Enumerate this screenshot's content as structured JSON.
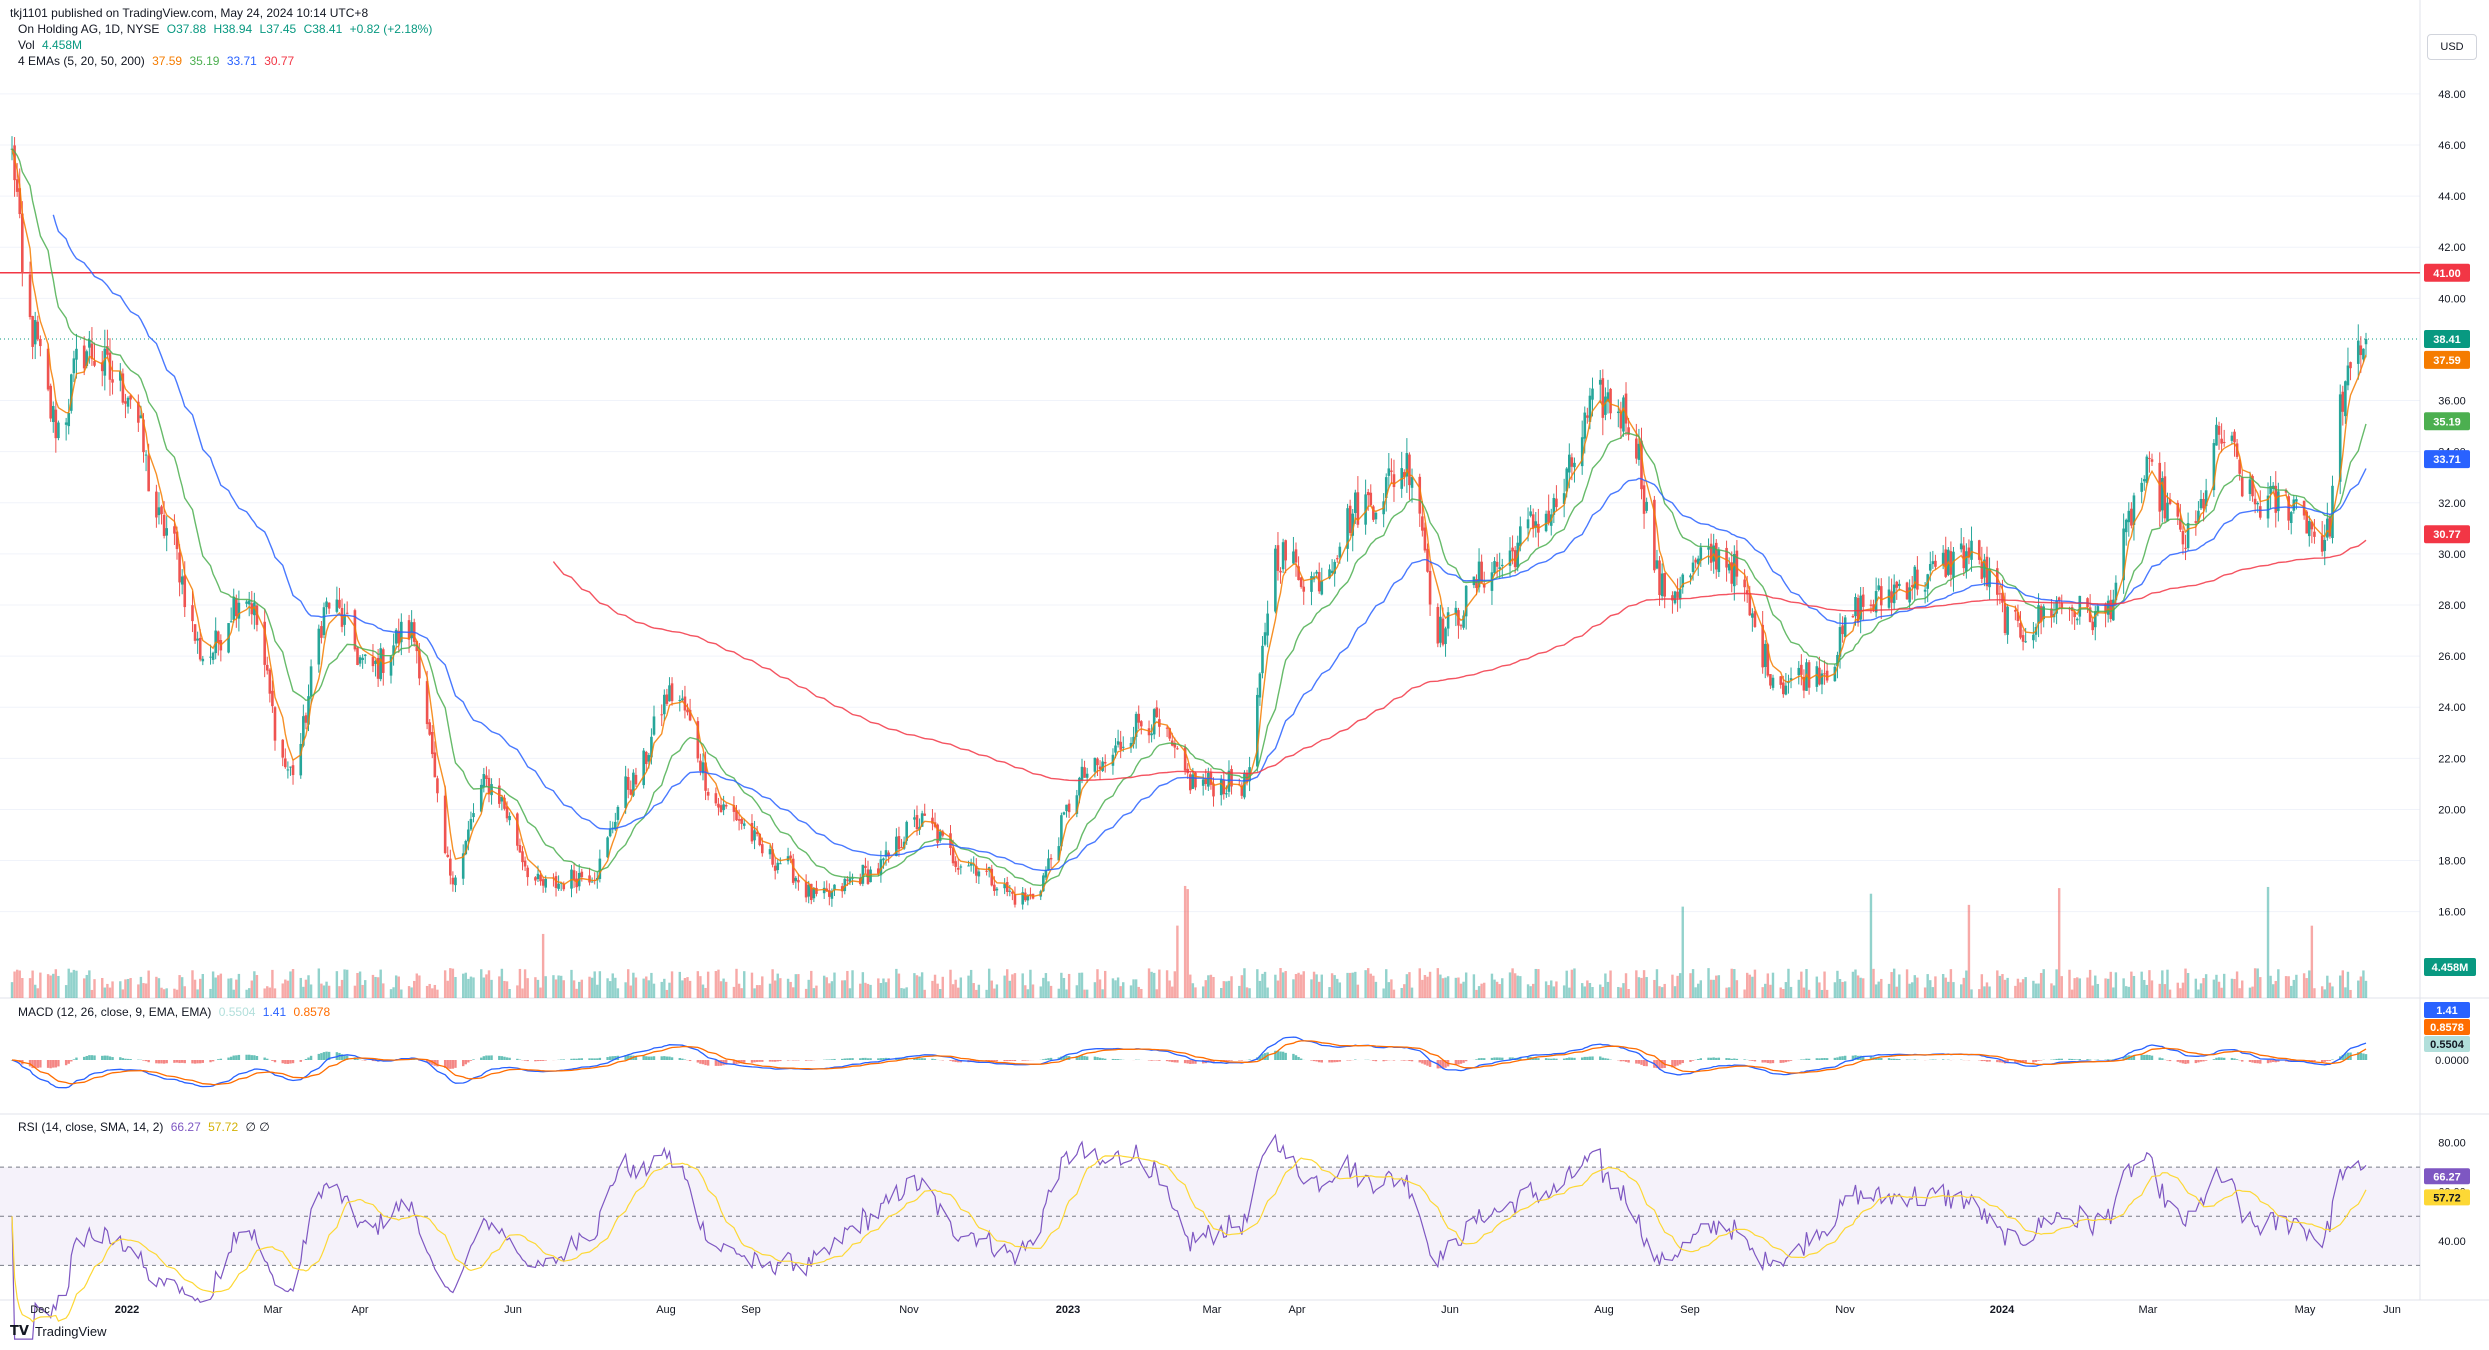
{
  "publisher": "tkj1101 published on TradingView.com, May 24, 2024 10:14 UTC+8",
  "legend": {
    "symbol": "On Holding AG, 1D, NYSE",
    "ohlc": {
      "open": "O37.88",
      "high": "H38.94",
      "low": "L37.45",
      "close": "C38.41",
      "change": "+0.82 (+2.18%)"
    },
    "vol_label": "Vol",
    "vol_value": "4.458M",
    "ema_label": "4 EMAs (5, 20, 50, 200)",
    "ema_values": [
      "37.59",
      "35.19",
      "33.71",
      "30.77"
    ],
    "macd_label": "MACD (12, 26, close, 9, EMA, EMA)",
    "macd_values": [
      "0.5504",
      "1.41",
      "0.8578"
    ],
    "rsi_label": "RSI (14, close, SMA, 14, 2)",
    "rsi_values": [
      "66.27",
      "57.72"
    ],
    "rsi_extra": "∅ ∅"
  },
  "currency": "USD",
  "footer_brand": "TradingView",
  "colors": {
    "up": "#26a69a",
    "down": "#ef5350",
    "ema5": "#f57c00",
    "ema20": "#4caf50",
    "ema50": "#2962ff",
    "ema200": "#f23645",
    "macd": "#2962ff",
    "signal": "#ff6d00",
    "rsi": "#7e57c2",
    "rsi_ma": "#fdd835",
    "resistance": "#f23645"
  },
  "chart_data": {
    "type": "candlestick",
    "resistance_level": 41.0,
    "last_close": 38.41,
    "price_axis_ticks": [
      16,
      18,
      20,
      22,
      24,
      26,
      28,
      30,
      32,
      34,
      36,
      40,
      42,
      44,
      46,
      48
    ],
    "price_badges": [
      {
        "label": "41.00",
        "value": 41.0,
        "color": "#f23645"
      },
      {
        "label": "38.41",
        "value": 38.41,
        "color": "#089981"
      },
      {
        "label": "37.59",
        "value": 37.59,
        "color": "#f57c00"
      },
      {
        "label": "35.19",
        "value": 35.19,
        "color": "#4caf50"
      },
      {
        "label": "33.71",
        "value": 33.71,
        "color": "#2962ff"
      },
      {
        "label": "30.77",
        "value": 30.77,
        "color": "#f23645"
      }
    ],
    "vol_badge": "4.458M",
    "macd_axis": {
      "ticks": [
        "0.0000"
      ],
      "badges": [
        {
          "label": "1.41",
          "color": "#2962ff"
        },
        {
          "label": "0.8578",
          "color": "#ff6d00"
        },
        {
          "label": "0.5504",
          "color": "#b2dfdb"
        }
      ]
    },
    "rsi_axis": {
      "ticks": [
        80.0,
        60.0,
        40.0
      ],
      "ticks_labels": [
        "80.00",
        "60.00",
        "40.00"
      ],
      "upper": 70,
      "lower": 30,
      "badges": [
        {
          "label": "66.27",
          "color": "#7e57c2"
        },
        {
          "label": "57.72",
          "color": "#fdd835"
        }
      ]
    },
    "x_labels": [
      "Dec",
      "2022",
      "Mar",
      "Apr",
      "Jun",
      "Aug",
      "Sep",
      "Nov",
      "2023",
      "Mar",
      "Apr",
      "Jun",
      "Aug",
      "Sep",
      "Nov",
      "2024",
      "Mar",
      "May",
      "Jun"
    ],
    "keypoints": [
      [
        "2021-11-22",
        45.5
      ],
      [
        "2021-11-28",
        39.0
      ],
      [
        "2021-12-10",
        35.0
      ],
      [
        "2021-12-20",
        38.0
      ],
      [
        "2022-01-05",
        36.5
      ],
      [
        "2022-01-20",
        31.0
      ],
      [
        "2022-02-05",
        26.0
      ],
      [
        "2022-02-20",
        28.5
      ],
      [
        "2022-03-10",
        21.5
      ],
      [
        "2022-03-25",
        28.0
      ],
      [
        "2022-04-10",
        25.5
      ],
      [
        "2022-04-25",
        27.0
      ],
      [
        "2022-05-12",
        17.5
      ],
      [
        "2022-05-25",
        21.0
      ],
      [
        "2022-06-16",
        17.0
      ],
      [
        "2022-07-05",
        17.5
      ],
      [
        "2022-07-20",
        21.0
      ],
      [
        "2022-08-05",
        24.5
      ],
      [
        "2022-08-25",
        20.0
      ],
      [
        "2022-09-15",
        18.0
      ],
      [
        "2022-10-01",
        16.5
      ],
      [
        "2022-10-20",
        17.5
      ],
      [
        "2022-11-10",
        19.5
      ],
      [
        "2022-11-25",
        18.0
      ],
      [
        "2022-12-20",
        16.5
      ],
      [
        "2023-01-15",
        21.5
      ],
      [
        "2023-02-05",
        23.5
      ],
      [
        "2023-02-25",
        21.0
      ],
      [
        "2023-03-15",
        21.0
      ],
      [
        "2023-03-28",
        30.0
      ],
      [
        "2023-04-10",
        29.0
      ],
      [
        "2023-05-01",
        32.0
      ],
      [
        "2023-05-18",
        33.5
      ],
      [
        "2023-05-30",
        27.0
      ],
      [
        "2023-06-20",
        29.5
      ],
      [
        "2023-07-10",
        31.5
      ],
      [
        "2023-08-01",
        36.0
      ],
      [
        "2023-08-10",
        35.5
      ],
      [
        "2023-08-25",
        28.5
      ],
      [
        "2023-09-15",
        30.0
      ],
      [
        "2023-10-10",
        25.0
      ],
      [
        "2023-10-25",
        25.5
      ],
      [
        "2023-11-10",
        28.0
      ],
      [
        "2023-12-01",
        29.0
      ],
      [
        "2023-12-20",
        30.0
      ],
      [
        "2024-01-10",
        27.0
      ],
      [
        "2024-01-25",
        28.0
      ],
      [
        "2024-02-10",
        27.5
      ],
      [
        "2024-02-28",
        33.0
      ],
      [
        "2024-03-15",
        30.5
      ],
      [
        "2024-03-28",
        34.5
      ],
      [
        "2024-04-10",
        32.0
      ],
      [
        "2024-04-25",
        32.0
      ],
      [
        "2024-05-07",
        30.5
      ],
      [
        "2024-05-15",
        36.5
      ],
      [
        "2024-05-23",
        38.4
      ]
    ]
  }
}
